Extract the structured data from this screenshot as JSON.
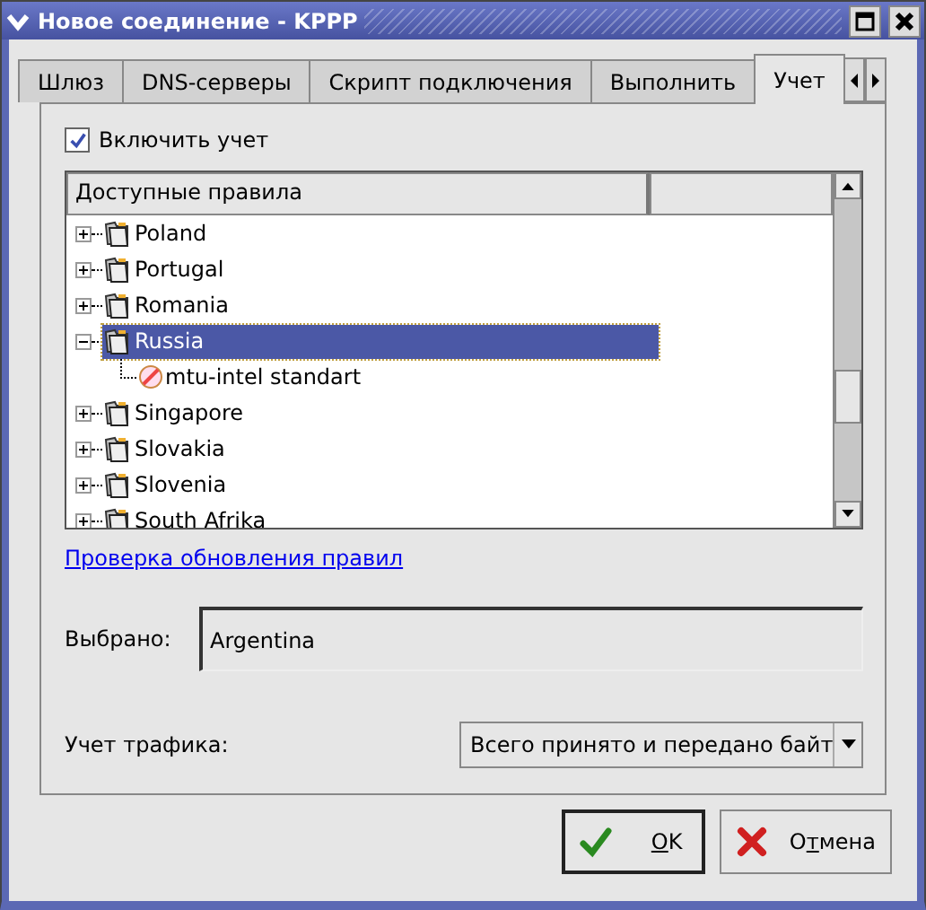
{
  "window": {
    "title": "Новое соединение - KPPP"
  },
  "tabs": [
    {
      "label": "Шлюз",
      "selected": false
    },
    {
      "label": "DNS-серверы",
      "selected": false
    },
    {
      "label": "Скрипт подключения",
      "selected": false
    },
    {
      "label": "Выполнить",
      "selected": false
    },
    {
      "label": "Учет",
      "selected": true
    }
  ],
  "enable_accounting": {
    "label": "Включить учет",
    "checked": true
  },
  "tree": {
    "columns": [
      "Доступные правила"
    ],
    "items": [
      {
        "label": "Poland",
        "expanded": false,
        "selected": false
      },
      {
        "label": "Portugal",
        "expanded": false,
        "selected": false
      },
      {
        "label": "Romania",
        "expanded": false,
        "selected": false
      },
      {
        "label": "Russia",
        "expanded": true,
        "selected": true,
        "children": [
          {
            "label": "mtu-intel standart"
          }
        ]
      },
      {
        "label": "Singapore",
        "expanded": false,
        "selected": false
      },
      {
        "label": "Slovakia",
        "expanded": false,
        "selected": false
      },
      {
        "label": "Slovenia",
        "expanded": false,
        "selected": false
      },
      {
        "label": "South Afrika",
        "expanded": false,
        "selected": false
      }
    ]
  },
  "update_link": "Проверка обновления правил",
  "selected_field": {
    "label": "Выбрано:",
    "value": "Argentina"
  },
  "traffic": {
    "label": "Учет трафика:",
    "value": "Всего принято и передано байт"
  },
  "buttons": [
    {
      "label": {
        "key": "O",
        "after": "K"
      },
      "kind": "ok",
      "default": true
    },
    {
      "label": {
        "before": "О",
        "key": "т",
        "after": "мена"
      },
      "kind": "cancel",
      "default": false
    }
  ]
}
